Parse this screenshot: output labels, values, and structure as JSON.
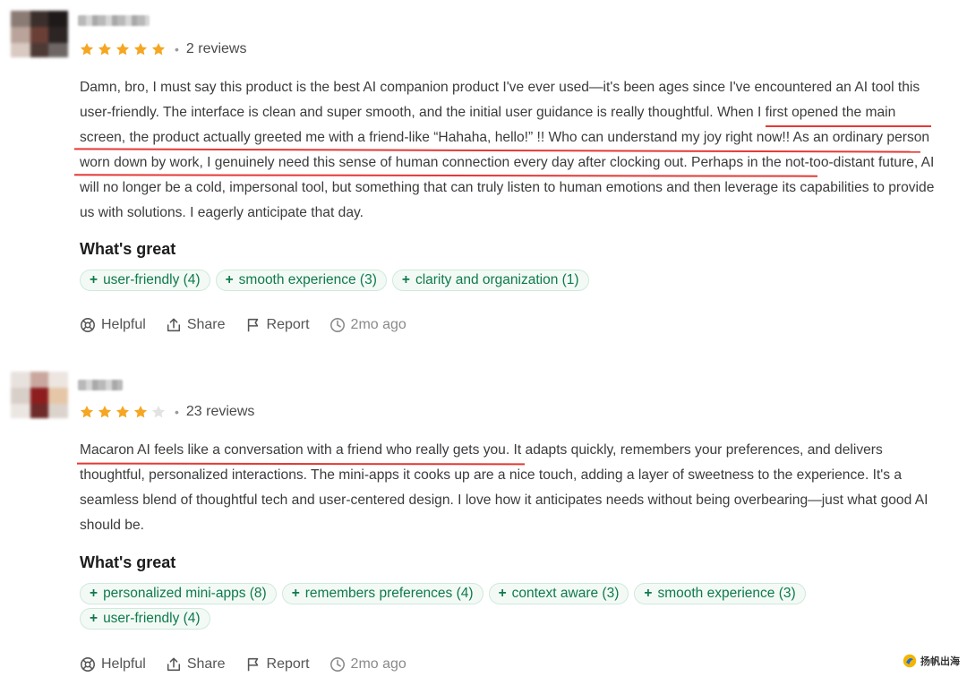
{
  "colors": {
    "star_filled": "#f5a623",
    "star_empty": "#e3e3e3",
    "tag_text": "#0f7a4c",
    "tag_bg": "#f3faf6",
    "tag_border": "#cfe9dc",
    "underline": "#e53935"
  },
  "reviews": [
    {
      "rating": 5,
      "review_count": "2 reviews",
      "body_plain_1": "Damn, bro, I must say this product is the best AI companion product I've ever used—it's been ages since I've encountered an AI tool this user-friendly. The interface is clean and super smooth, and the initial user guidance is really thoughtful. ",
      "body_highlight": "When I first opened the main screen, the product actually greeted me with a friend-like “Hahaha, hello!” !! Who can understand my joy right now!! As an ordinary person worn down by work, I genuinely need this sense of human connection every day after clocking out.",
      "body_plain_2": " Perhaps in the not-too-distant future, AI will no longer be a cold, impersonal tool, but something that can truly listen to human emotions and then leverage its capabilities to provide us with solutions. I eagerly anticipate that day.",
      "whats_great_title": "What's great",
      "tags": [
        "user-friendly (4)",
        "smooth experience (3)",
        "clarity and organization (1)"
      ],
      "actions": {
        "helpful": "Helpful",
        "share": "Share",
        "report": "Report",
        "time": "2mo ago"
      }
    },
    {
      "rating": 4,
      "review_count": "23 reviews",
      "body_highlight": "Macaron AI feels like a conversation with a friend who really gets you.",
      "body_plain_2": " It adapts quickly, remembers your preferences, and delivers thoughtful, personalized interactions. The mini-apps it cooks up are a nice touch, adding a layer of sweetness to the experience. It's a seamless blend of thoughtful tech and user-centered design. I love how it anticipates needs without being overbearing—just what good AI should be.",
      "whats_great_title": "What's great",
      "tags": [
        "personalized mini-apps (8)",
        "remembers preferences (4)",
        "context aware (3)",
        "smooth experience (3)",
        "user-friendly (4)"
      ],
      "actions": {
        "helpful": "Helpful",
        "share": "Share",
        "report": "Report",
        "time": "2mo ago"
      }
    }
  ],
  "watermark": {
    "text": "扬帆出海"
  }
}
